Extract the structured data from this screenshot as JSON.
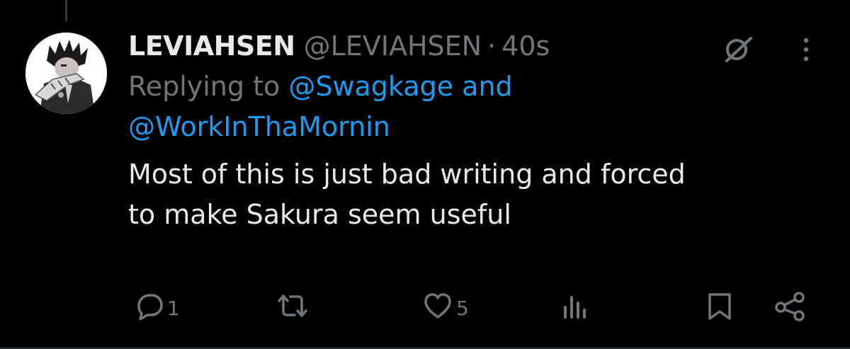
{
  "tweet": {
    "display_name": "LEVIAHSEN",
    "handle": "@LEVIAHSEN",
    "separator": "·",
    "time": "40s",
    "replying_prefix": "Replying to",
    "mention_1": "@Swagkage",
    "and": "and",
    "mention_2": "@WorkInThaMornin",
    "text_line_1": "Most of this is just bad writing and forced",
    "text_line_2": "to make Sakura seem useful"
  },
  "actions": {
    "reply_count": "1",
    "like_count": "5"
  },
  "icons": {
    "top": [
      "grok-icon",
      "more-icon"
    ],
    "actions": [
      "reply-icon",
      "retweet-icon",
      "like-icon",
      "views-icon",
      "bookmark-icon",
      "share-icon"
    ]
  },
  "colors": {
    "background": "#000000",
    "primary_text": "#e7e9ea",
    "secondary_text": "#71767b",
    "link": "#1d9bf0"
  }
}
